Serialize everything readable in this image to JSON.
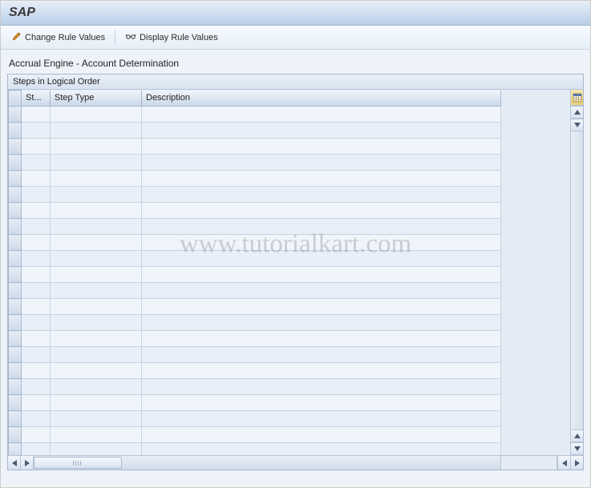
{
  "app_title": "SAP",
  "toolbar": {
    "change_label": "Change Rule Values",
    "display_label": "Display Rule Values"
  },
  "page": {
    "heading": "Accrual Engine - Account Determination"
  },
  "grid": {
    "title": "Steps in Logical Order",
    "columns": {
      "step_no": "St...",
      "step_type": "Step Type",
      "description": "Description"
    },
    "row_count": 22
  },
  "watermark": "www.tutorialkart.com"
}
